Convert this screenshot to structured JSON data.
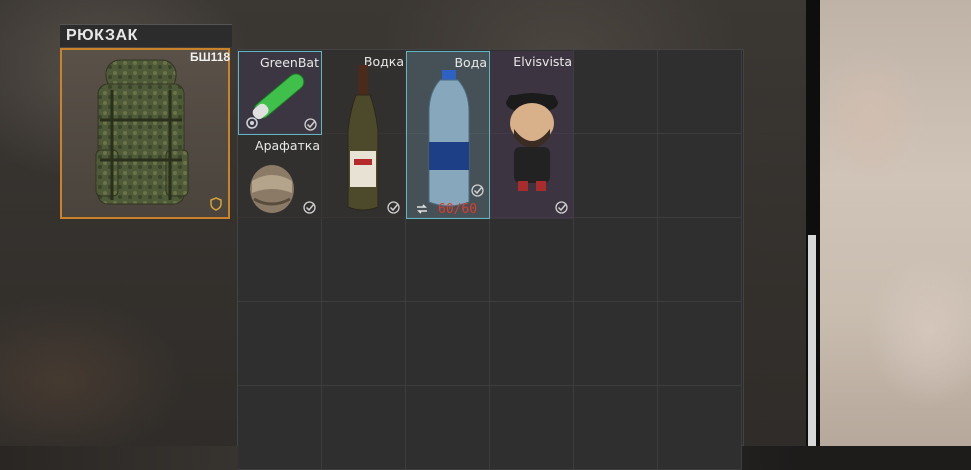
{
  "backpack": {
    "title": "РЮКЗАК",
    "model": "БШ118",
    "slot_border_color": "#c9832a",
    "shield_icon": "shield-icon"
  },
  "inventory": {
    "columns": 6,
    "rows": 5,
    "items": [
      {
        "name": "GreenBat",
        "icon": "green-tube-icon",
        "status": "check-icon",
        "extra": "rotate-icon",
        "selected": true
      },
      {
        "name": "Водка",
        "icon": "vodka-bottle-icon",
        "status": "check-icon"
      },
      {
        "name": "Вода",
        "icon": "water-bottle-icon",
        "status": "check-icon",
        "extra": "swap-icon",
        "count": "60/60",
        "selected": true
      },
      {
        "name": "Elvisvista",
        "icon": "figure-icon",
        "status": "check-icon"
      },
      {
        "name": "Арафатка",
        "icon": "headscarf-icon",
        "status": "check-icon"
      }
    ]
  },
  "colors": {
    "highlight_border": "#5fb7c2",
    "count_text": "#e03c2a",
    "scrollbar": "#d8d8d8"
  }
}
